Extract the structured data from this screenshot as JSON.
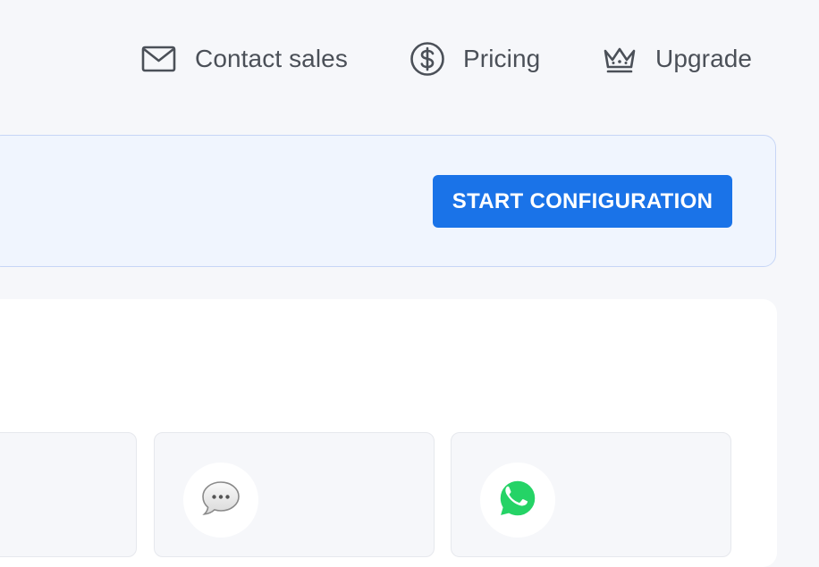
{
  "nav": {
    "contact": {
      "label": "Contact sales",
      "icon": "envelope-icon"
    },
    "pricing": {
      "label": "Pricing",
      "icon": "dollar-circle-icon"
    },
    "upgrade": {
      "label": "Upgrade",
      "icon": "crown-icon"
    }
  },
  "banner": {
    "button_label": "START CONFIGURATION"
  },
  "channels": [
    {
      "icon": "channel-icon"
    },
    {
      "icon": "imessage-icon"
    },
    {
      "icon": "whatsapp-icon"
    }
  ],
  "colors": {
    "accent": "#1a73e8",
    "page_bg": "#f6f7fa",
    "banner_bg": "#f0f5fe",
    "banner_border": "#c7d6f6",
    "nav_text": "#4b5058",
    "whatsapp": "#25d366"
  }
}
